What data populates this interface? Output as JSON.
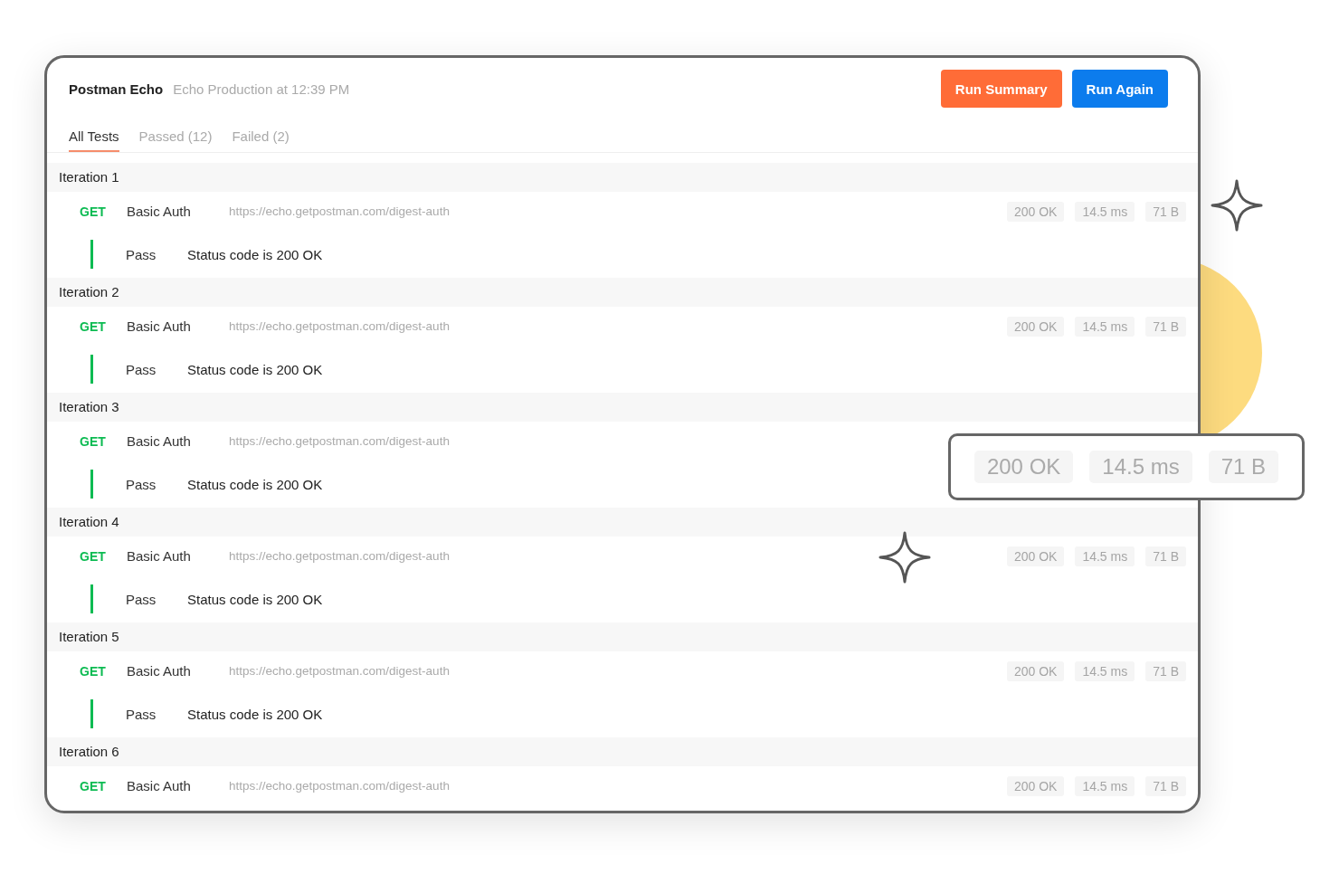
{
  "header": {
    "title": "Postman Echo",
    "subtitle": "Echo Production at 12:39 PM"
  },
  "buttons": [
    {
      "label": "Run Summary",
      "kind": "summary"
    },
    {
      "label": "Run Again",
      "kind": "primary"
    }
  ],
  "tabs": [
    {
      "label": "All Tests",
      "selected": true
    },
    {
      "label": "Passed (12)",
      "selected": false
    },
    {
      "label": "Failed (2)",
      "selected": false
    }
  ],
  "iterations": [
    {
      "title": "Iteration 1",
      "requests": [
        {
          "method": "GET",
          "name": "Basic Auth",
          "url": "https://echo.getpostman.com/digest-auth",
          "metrics": [
            "200 OK",
            "14.5 ms",
            "71 B"
          ],
          "tests": [
            {
              "result": "Pass",
              "name": "Status code is 200 OK",
              "passed": true
            }
          ]
        }
      ]
    },
    {
      "title": "Iteration 2",
      "requests": [
        {
          "method": "GET",
          "name": "Basic Auth",
          "url": "https://echo.getpostman.com/digest-auth",
          "metrics": [
            "200 OK",
            "14.5 ms",
            "71 B"
          ],
          "tests": [
            {
              "result": "Pass",
              "name": "Status code is 200 OK",
              "passed": true
            }
          ]
        }
      ]
    },
    {
      "title": "Iteration 3",
      "requests": [
        {
          "method": "GET",
          "name": "Basic Auth",
          "url": "https://echo.getpostman.com/digest-auth",
          "tests": [
            {
              "result": "Pass",
              "name": "Status code is 200 OK",
              "passed": true
            }
          ]
        }
      ]
    },
    {
      "title": "Iteration 4",
      "requests": [
        {
          "method": "GET",
          "name": "Basic Auth",
          "url": "https://echo.getpostman.com/digest-auth",
          "metrics": [
            "200 OK",
            "14.5 ms",
            "71 B"
          ],
          "tests": [
            {
              "result": "Pass",
              "name": "Status code is 200 OK",
              "passed": true
            }
          ]
        }
      ]
    },
    {
      "title": "Iteration 5",
      "requests": [
        {
          "method": "GET",
          "name": "Basic Auth",
          "url": "https://echo.getpostman.com/digest-auth",
          "metrics": [
            "200 OK",
            "14.5 ms",
            "71 B"
          ],
          "tests": [
            {
              "result": "Pass",
              "name": "Status code is 200 OK",
              "passed": true
            }
          ]
        }
      ]
    },
    {
      "title": "Iteration 6",
      "requests": [
        {
          "method": "GET",
          "name": "Basic Auth",
          "url": "https://echo.getpostman.com/digest-auth",
          "metrics": [
            "200 OK",
            "14.5 ms",
            "71 B"
          ]
        }
      ]
    }
  ],
  "callout": {
    "metrics": [
      "200 OK",
      "14.5 ms",
      "71 B"
    ]
  }
}
